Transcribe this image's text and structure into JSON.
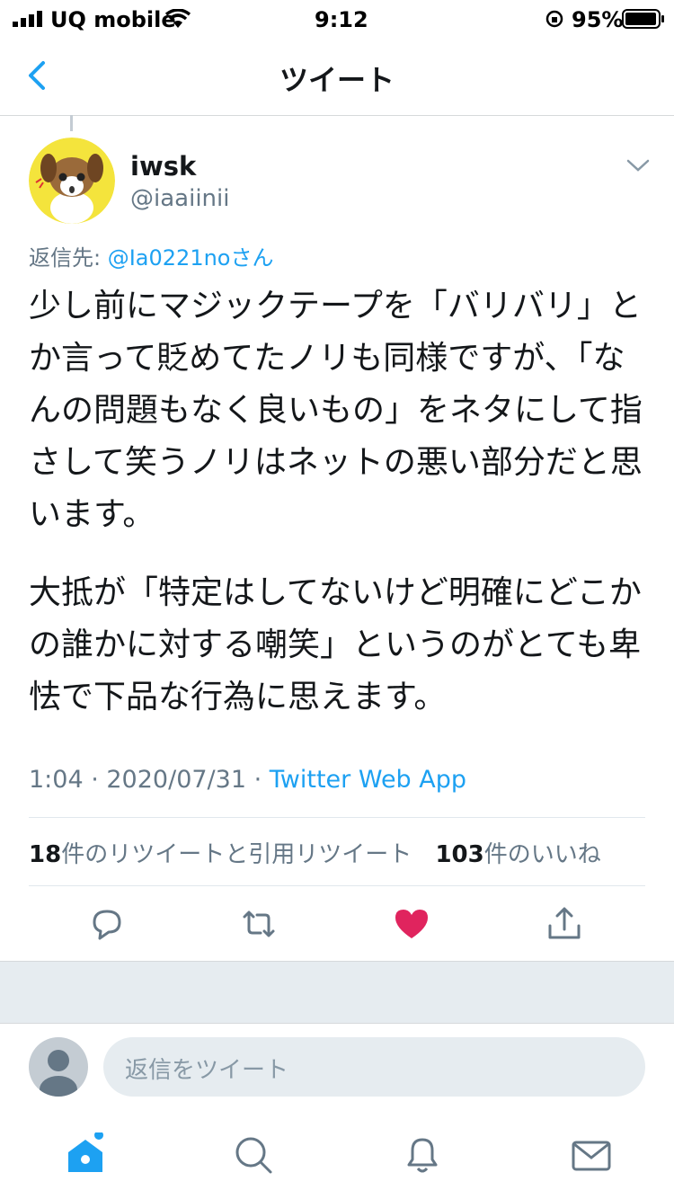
{
  "status_bar": {
    "carrier": "UQ mobile",
    "time": "9:12",
    "battery": "95%"
  },
  "nav": {
    "title": "ツイート",
    "back_icon": "chevron-left-icon"
  },
  "tweet": {
    "author_name": "iwsk",
    "author_handle": "@iaaiinii",
    "reply_prefix": "返信先: ",
    "reply_mention": "@Ia0221noさん",
    "paragraphs": [
      "少し前にマジックテープを「バリバリ」とか言って貶めてたノリも同様ですが、「なんの問題もなく良いもの」をネタにして指さして笑うノリはネットの悪い部分だと思います。",
      "大抵が「特定はしてないけど明確にどこかの誰かに対する嘲笑」というのがとても卑怯で下品な行為に思えます。"
    ],
    "timestamp": "1:04 · 2020/07/31 · ",
    "via": "Twitter Web App",
    "retweets_count": "18",
    "retweets_label": "件のリツイートと引用リツイート",
    "likes_count": "103",
    "likes_label": "件のいいね"
  },
  "actions": [
    "reply-icon",
    "retweet-icon",
    "like-icon",
    "share-icon"
  ],
  "reply_composer": {
    "placeholder": "返信をツイート"
  },
  "tabs": [
    "home-icon",
    "search-icon",
    "notifications-icon",
    "messages-icon"
  ],
  "colors": {
    "accent": "#1da1f2",
    "like": "#e0245e",
    "secondary_text": "#657786"
  }
}
